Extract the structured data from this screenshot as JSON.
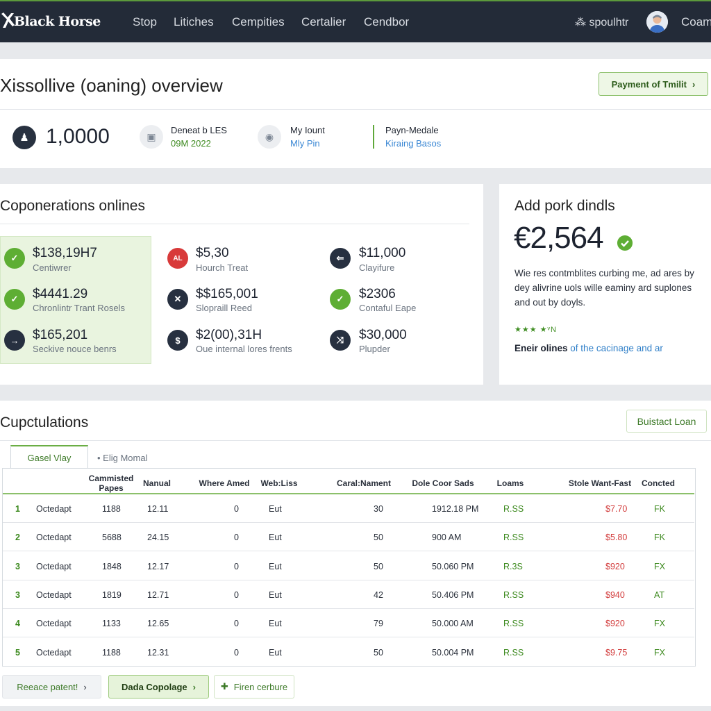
{
  "nav": {
    "brand": "Black Horse",
    "links": [
      "Stop",
      "Litiches",
      "Cempities",
      "Certalier",
      "Cendbor"
    ],
    "user": "spoulhtr",
    "company": "Coam"
  },
  "overview": {
    "title": "Xissollive (oaning) overview",
    "action_label": "Payment of Tmilit",
    "big_number": "1,0000",
    "info": [
      {
        "top": "Deneat b LES",
        "bottom": "09M 2022"
      },
      {
        "top": "My Iount",
        "bottom": "Mly Pin"
      },
      {
        "top": "Payn-Medale",
        "bottom": "Kiraing Basos"
      }
    ]
  },
  "operations": {
    "title": "Coponerations onlines",
    "items": [
      {
        "amount": "$138,19H7",
        "label": "Centiwrer",
        "icon": "check-icon",
        "icon_text": "✓"
      },
      {
        "amount": "$4441.29",
        "label": "Chronlintr Trant Rosels",
        "icon": "check-icon",
        "icon_text": "✓"
      },
      {
        "amount": "$165,201",
        "label": "Seckive nouce benrs",
        "icon": "arrow-right-icon",
        "icon_text": "→"
      },
      {
        "amount": "$5,30",
        "label": "Hourch Treat",
        "icon": "alert-icon",
        "icon_text": "AL"
      },
      {
        "amount": "$$165,001",
        "label": "Slopraill Reed",
        "icon": "tools-icon",
        "icon_text": "✕"
      },
      {
        "amount": "$2(00),31H",
        "label": "Oue internal lores frents",
        "icon": "dollar-icon",
        "icon_text": "$"
      },
      {
        "amount": "$11,000",
        "label": "Clayifure",
        "icon": "back-arrow-icon",
        "icon_text": "⇐"
      },
      {
        "amount": "$2306",
        "label": "Contaful Eape",
        "icon": "check-icon",
        "icon_text": "✓"
      },
      {
        "amount": "$30,000",
        "label": "Plupder",
        "icon": "shuffle-icon",
        "icon_text": "⤨"
      }
    ]
  },
  "addpork": {
    "title": "Add pork dindls",
    "amount": "€2,564",
    "description": "Wie res contmblites curbing me, ad ares by dey alivrine uols wille eaminy ard suplones and out by doyls.",
    "stars": "★★★ ★ᵛN",
    "footer_bold": "Eneir olines",
    "footer_link": "of the cacinage and ar"
  },
  "cupculations": {
    "title": "Cupctulations",
    "action_label": "Buistact Loan",
    "tabs": [
      "Gasel Vlay",
      "Elig Momal"
    ],
    "columns": [
      "Cammisted Papes",
      "Nanual",
      "Where Amed",
      "Web:Liss",
      "Caral:Nament",
      "Dole Coor Sads",
      "Loams",
      "Stole Want-Fast",
      "Concted"
    ],
    "rows": [
      {
        "rank": "1",
        "name": "Octedapt",
        "papes": "1188",
        "manual": "12.11",
        "where": "0",
        "web": "Eut",
        "caral": "30",
        "dole": "1912.18 PM",
        "loams": "R.SS",
        "stole": "$7.70",
        "concted": "FK"
      },
      {
        "rank": "2",
        "name": "Octedapt",
        "papes": "5688",
        "manual": "24.15",
        "where": "0",
        "web": "Eut",
        "caral": "50",
        "dole": "900 AM",
        "loams": "R.SS",
        "stole": "$5.80",
        "concted": "FK"
      },
      {
        "rank": "3",
        "name": "Octedapt",
        "papes": "1848",
        "manual": "12.17",
        "where": "0",
        "web": "Eut",
        "caral": "50",
        "dole": "50.060 PM",
        "loams": "R.3S",
        "stole": "$920",
        "concted": "FX"
      },
      {
        "rank": "3",
        "name": "Octedapt",
        "papes": "1819",
        "manual": "12.71",
        "where": "0",
        "web": "Eut",
        "caral": "42",
        "dole": "50.406 PM",
        "loams": "R.SS",
        "stole": "$940",
        "concted": "AT"
      },
      {
        "rank": "4",
        "name": "Octedapt",
        "papes": "1133",
        "manual": "12.65",
        "where": "0",
        "web": "Eut",
        "caral": "79",
        "dole": "50.000 AM",
        "loams": "R.SS",
        "stole": "$920",
        "concted": "FX"
      },
      {
        "rank": "5",
        "name": "Octedapt",
        "papes": "1188",
        "manual": "12.31",
        "where": "0",
        "web": "Eut",
        "caral": "50",
        "dole": "50.004 PM",
        "loams": "R.SS",
        "stole": "$9.75",
        "concted": "FX"
      }
    ],
    "footer_buttons": [
      "Reeace patent!",
      "Dada Copolage",
      "Firen cerbure"
    ]
  },
  "colors": {
    "nav_bg": "#232b38",
    "accent_green": "#5eae34",
    "danger_red": "#d23b3b",
    "link_blue": "#2f7fc8"
  }
}
